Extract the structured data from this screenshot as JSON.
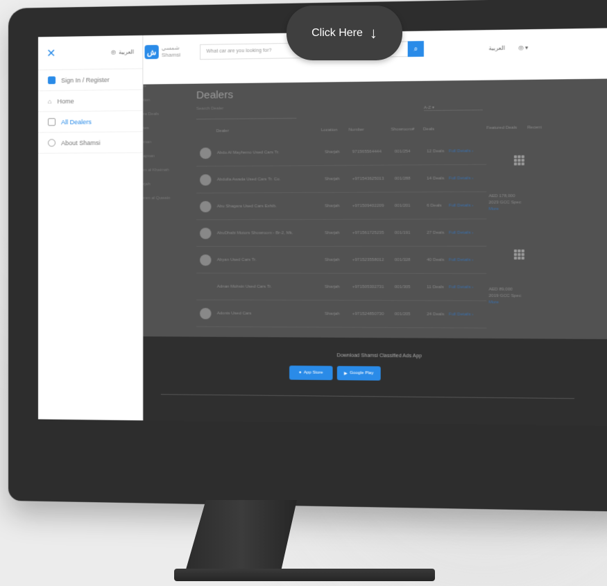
{
  "cta": {
    "label": "Click Here",
    "arrow": "↓"
  },
  "drawer": {
    "close": "✕",
    "lang": "العربية",
    "signin": "Sign In / Register",
    "items": [
      "Home",
      "All Dealers",
      "About Shamsi"
    ]
  },
  "header": {
    "logo_ar": "شمسي",
    "logo_en": "Shamsi",
    "search_placeholder": "What car are you looking for?",
    "search_icon": "⌕",
    "lang": "العربية",
    "user": "◎ ▾"
  },
  "page": {
    "title": "Dealers",
    "filter_placeholder": "Search Dealer",
    "sort": "A-Z",
    "left_menu": [
      "is",
      "tion",
      "ra Deals",
      "tes",
      "man",
      "ajman",
      "m al Khaimah",
      "rjah",
      "mm al Quwain"
    ],
    "columns": [
      "Dealer",
      "Location",
      "Number",
      "Showroom#",
      "Deals"
    ],
    "rows": [
      {
        "name": "Abdo Al Mayhemo Used Cars Tr.",
        "loc": "Sharjah",
        "num": "971565564444",
        "show": "001/254",
        "deals": "12 Deals",
        "link": "Full Details ›"
      },
      {
        "name": "Abdulla Awada Used Cars Tr. Co.",
        "loc": "Sharjah",
        "num": "+971543625013",
        "show": "001/288",
        "deals": "14 Deals",
        "link": "Full Details ›"
      },
      {
        "name": "Abu Shagara Used Cars Exhib.",
        "loc": "Sharjah",
        "num": "+971509402209",
        "show": "001/201",
        "deals": "6 Deals",
        "link": "Full Details ›"
      },
      {
        "name": "AbuDhabi Motors Showroom - Br-2, Mk.",
        "loc": "Sharjah",
        "num": "+971561725235",
        "show": "001/191",
        "deals": "27 Deals",
        "link": "Full Details ›"
      },
      {
        "name": "Abyan Used Cars Tr.",
        "loc": "Sharjah",
        "num": "+971523558012",
        "show": "001/328",
        "deals": "40 Deals",
        "link": "Full Details ›"
      },
      {
        "name": "Adnan Mohsin Used Cars Tr.",
        "loc": "Sharjah",
        "num": "+971505302731",
        "show": "001/305",
        "deals": "11 Deals",
        "link": "Full Details ›"
      },
      {
        "name": "Adonis Used Cars",
        "loc": "Sharjah",
        "num": "+971524850730",
        "show": "001/205",
        "deals": "24 Deals",
        "link": "Full Details ›"
      }
    ]
  },
  "featured": {
    "tabs": [
      "Featured Deals",
      "Recent"
    ],
    "items": [
      {
        "price": "AED 178,000",
        "spec": "2023 GCC Spec",
        "more": "More"
      },
      {
        "price": "AED 89,000",
        "spec": "2019 GCC Spec",
        "more": "More"
      }
    ]
  },
  "footer": {
    "title": "Download Shamsi Classified Ads App",
    "app_store": "App Store",
    "google_play": "Google Play"
  }
}
